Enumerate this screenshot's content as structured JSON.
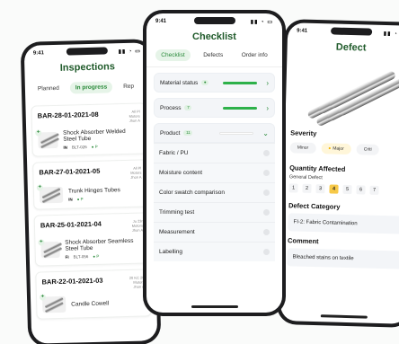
{
  "status_time": "9:41",
  "status_icons": "▮▮ ◔ ▭",
  "inspections": {
    "title": "Inspections",
    "tabs": [
      "Planned",
      "In progress",
      "Rep"
    ],
    "cards": [
      {
        "id": "BAR-28-01-2021-08",
        "meta": "All Pl\nMotors\nJhon A",
        "name": "Shock Absorber Welded Steel Tube",
        "tag": "IN",
        "code": "BLT-026",
        "status": "● P"
      },
      {
        "id": "BAR-27-01-2021-05",
        "meta": "All Pl\nMotors\nJhon A",
        "name": "Trunk Hinges Tubes",
        "tag": "IN",
        "code": "",
        "status": "● P"
      },
      {
        "id": "BAR-25-01-2021-04",
        "meta": "Ju 23r\nMotors\nJhon A",
        "name": "Shock Absorber Seamless Steel Tube",
        "tag": "FI",
        "code": "BLT-056",
        "status": "● P"
      },
      {
        "id": "BAR-22-01-2021-03",
        "meta": "20 KC 20\nMotors\nJhon A",
        "name": "Candle Cowell",
        "tag": "",
        "code": "",
        "status": ""
      }
    ]
  },
  "checklist": {
    "title": "Checklist",
    "tabs": [
      "Checklist",
      "Defects",
      "Order info"
    ],
    "rows": [
      {
        "label": "Material status",
        "count": "●"
      },
      {
        "label": "Process",
        "count": "7"
      },
      {
        "label": "Product",
        "count": "11"
      }
    ],
    "subitems": [
      "Fabric / PU",
      "Moisture content",
      "Color swatch comparison",
      "Trimming test",
      "Measurement",
      "Labelling"
    ]
  },
  "defect": {
    "title": "Defect",
    "severity_title": "Severity",
    "severities": [
      "Minor",
      "Major",
      "Criti"
    ],
    "quantity_title": "Quantity Affected",
    "general_defect": "General Defect",
    "numbers": [
      "1",
      "2",
      "3",
      "4",
      "5",
      "6",
      "7"
    ],
    "selected_number": "4",
    "category_title": "Defect Category",
    "category_value": "FI-2: Fabric Contamination",
    "comment_title": "Comment",
    "comment_value": "Bleached stains on textile"
  },
  "colors": {
    "accent": "#2eb14a",
    "title": "#1f5a2a",
    "major": "#f7c948"
  }
}
